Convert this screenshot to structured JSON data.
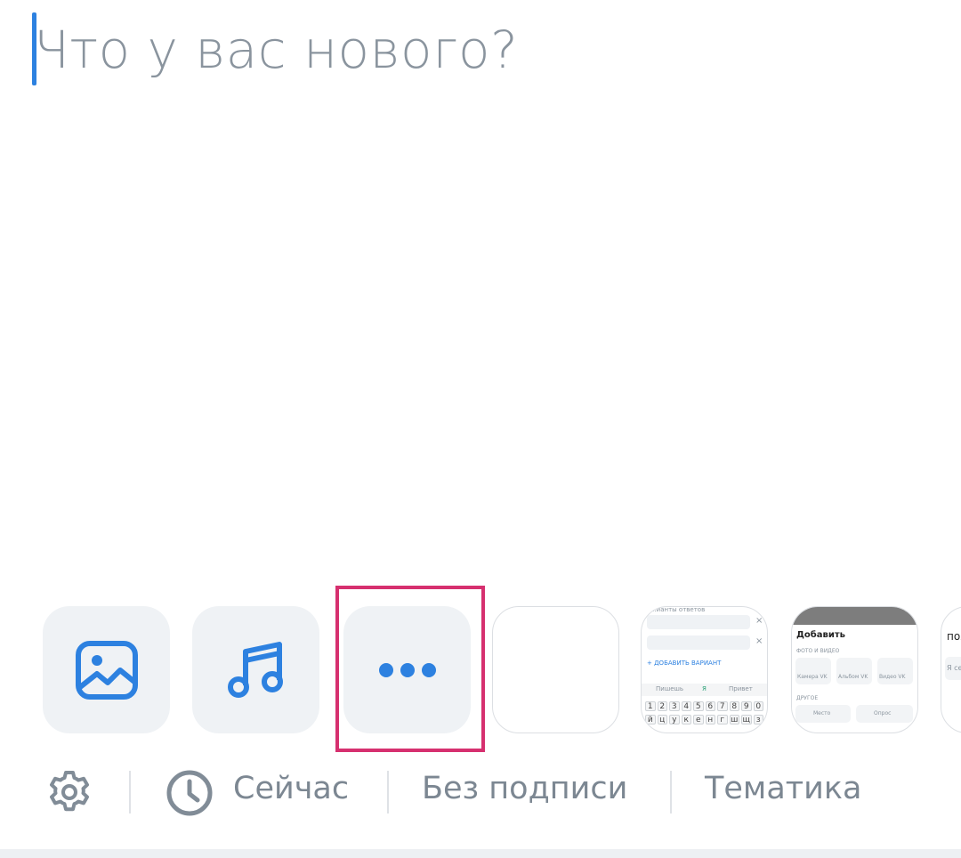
{
  "composer": {
    "placeholder": "Что у вас нового?"
  },
  "attachments": {
    "photo_icon": "photo-icon",
    "music_icon": "music-icon",
    "more_icon": "more-dots-icon",
    "accent_color": "#2d81e0",
    "highlight_color": "#d6306f"
  },
  "thumbnails": {
    "poll": {
      "header": "...ианты ответов",
      "add_option": "+ ДОБАВИТЬ ВАРИАНТ",
      "suggestions": [
        "Пишешь",
        "Я",
        "Привет"
      ],
      "keys_row1": [
        "1",
        "2",
        "3",
        "4",
        "5",
        "6",
        "7",
        "8",
        "9",
        "0"
      ],
      "keys_row2": [
        "й",
        "ц",
        "у",
        "к",
        "е",
        "н",
        "г",
        "ш",
        "щ",
        "з"
      ]
    },
    "add_menu": {
      "title": "Добавить",
      "section1": "ФОТО И ВИДЕО",
      "items1": [
        "Камера VK",
        "Альбом VK",
        "Видео VK"
      ],
      "section2": "ДРУГОЕ",
      "items2": [
        "Место",
        "Опрос"
      ]
    },
    "partial": {
      "title": "пож",
      "line": "Я сен"
    }
  },
  "bottom_bar": {
    "settings_icon": "gear-icon",
    "time_icon": "clock-icon",
    "time_label": "Сейчас",
    "signature_label": "Без подписи",
    "topic_label": "Тематика"
  }
}
